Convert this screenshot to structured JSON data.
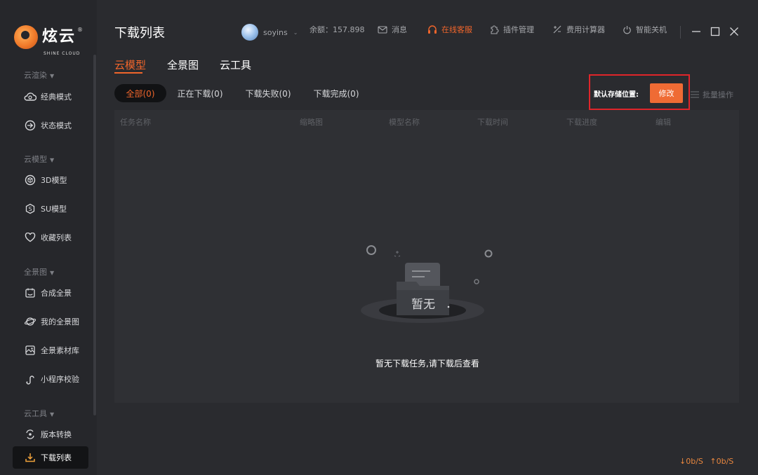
{
  "app": {
    "logo_text": "炫云",
    "logo_sub": "SHINE CLOUD",
    "logo_reg": "®"
  },
  "sidebar": {
    "sections": [
      {
        "title": "云渲染",
        "items": [
          {
            "label": "经典模式",
            "icon": "cloud-icon"
          },
          {
            "label": "状态模式",
            "icon": "status-icon"
          }
        ]
      },
      {
        "title": "云模型",
        "items": [
          {
            "label": "3D模型",
            "icon": "cube-icon"
          },
          {
            "label": "SU模型",
            "icon": "su-icon"
          },
          {
            "label": "收藏列表",
            "icon": "heart-icon"
          }
        ]
      },
      {
        "title": "全景图",
        "items": [
          {
            "label": "合成全景",
            "icon": "panorama-compose-icon"
          },
          {
            "label": "我的全景图",
            "icon": "planet-icon"
          },
          {
            "label": "全景素材库",
            "icon": "image-library-icon"
          },
          {
            "label": "小程序校验",
            "icon": "mini-program-icon"
          }
        ]
      },
      {
        "title": "云工具",
        "items": [
          {
            "label": "版本转换",
            "icon": "convert-icon"
          },
          {
            "label": "下载列表",
            "icon": "download-icon",
            "active": true
          }
        ]
      }
    ]
  },
  "header": {
    "page_title": "下载列表",
    "username": "soyins",
    "balance_label": "余额：157.898",
    "messages": "消息",
    "support": "在线客服",
    "plugins": "插件管理",
    "calculator": "费用计算器",
    "shutdown": "智能关机"
  },
  "tabs": [
    "云模型",
    "全景图",
    "云工具"
  ],
  "filters": [
    "全部(0)",
    "正在下载(0)",
    "下载失败(0)",
    "下载完成(0)"
  ],
  "toolbar": {
    "storage_label": "默认存储位置:",
    "modify_button": "修改",
    "batch_label": "批量操作"
  },
  "table": {
    "columns": [
      "任务名称",
      "缩略图",
      "模型名称",
      "下载时间",
      "下载进度",
      "编辑"
    ]
  },
  "empty_state": {
    "illustration_text": "暂无",
    "message": "暂无下载任务,请下载后查看"
  },
  "status": {
    "download_speed": "↓0b/S",
    "upload_speed": "↑0b/S"
  },
  "colors": {
    "accent": "#f0652b",
    "button": "#ef6b34",
    "highlight_border": "#e0252a",
    "background": "#2a2b2f",
    "sidebar": "#26272b"
  }
}
